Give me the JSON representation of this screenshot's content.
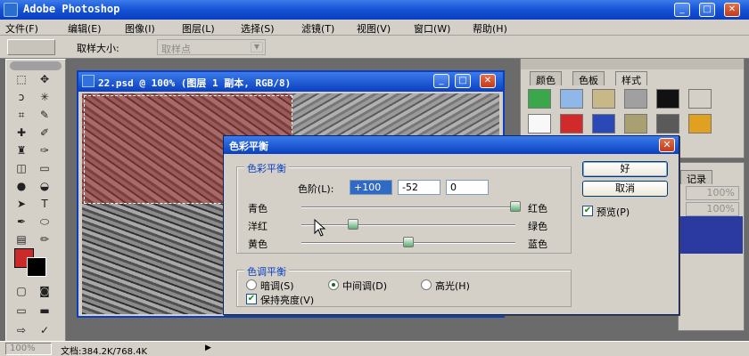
{
  "app": {
    "title": "Adobe Photoshop"
  },
  "menu": [
    "文件(F)",
    "编辑(E)",
    "图像(I)",
    "图层(L)",
    "选择(S)",
    "滤镜(T)",
    "视图(V)",
    "窗口(W)",
    "帮助(H)"
  ],
  "options": {
    "label": "取样大小:",
    "value": "取样点"
  },
  "document": {
    "title": "22.psd @ 100% (图层 1 副本, RGB/8)"
  },
  "panel_tabs": [
    "颜色",
    "色板",
    "样式"
  ],
  "panel2": {
    "tab": "记录",
    "pct1": "100%",
    "pct2": "100%"
  },
  "dialog": {
    "title": "色彩平衡",
    "group1": "色彩平衡",
    "levels_label": "色阶(L):",
    "levels": [
      "+100",
      "-52",
      "0"
    ],
    "sliders": [
      {
        "left": "青色",
        "right": "红色",
        "value": 100
      },
      {
        "left": "洋红",
        "right": "绿色",
        "value": -52
      },
      {
        "left": "黄色",
        "right": "蓝色",
        "value": 0
      }
    ],
    "group2": "色调平衡",
    "tones": {
      "shadows": "暗调(S)",
      "midtones": "中间调(D)",
      "highlights": "高光(H)"
    },
    "preserve": "保持亮度(V)",
    "ok": "好",
    "cancel": "取消",
    "preview": "预览(P)"
  },
  "status": {
    "zoom": "100%",
    "doc": "文档:384.2K/768.4K"
  },
  "colors": {
    "foreground": "#cc2a2a",
    "background": "#000000",
    "titlebar": "#0a3fc0"
  }
}
